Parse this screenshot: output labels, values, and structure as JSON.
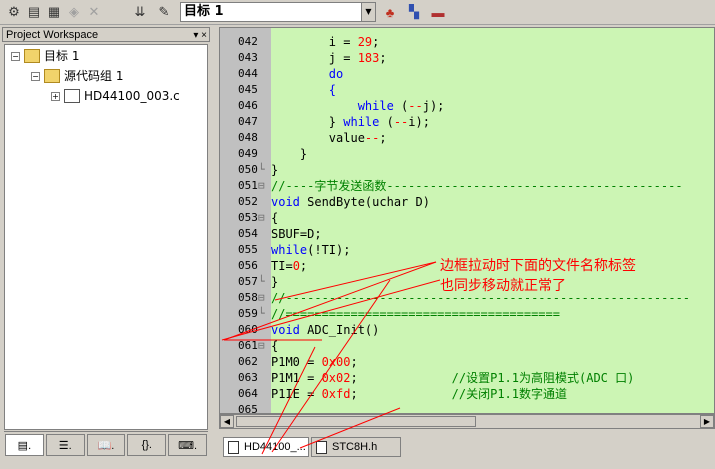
{
  "toolbar": {
    "target_value": "目标 1",
    "buttons": [
      "translate-icon",
      "build-icon",
      "rebuild-icon",
      "batch-build-icon",
      "stop-build-icon",
      "download-icon",
      "load-icon",
      "options-icon",
      "components-icon",
      "books-icon"
    ]
  },
  "workspace": {
    "title": "Project Workspace",
    "title_buttons": "▾ ×",
    "tree": {
      "root": "目标 1",
      "group": "源代码组 1",
      "file": "HD44100_003.c"
    },
    "tabs": [
      "▤.",
      "☰.",
      "📖.",
      "{}.",
      "⌨."
    ]
  },
  "editor": {
    "lines": [
      {
        "n": "042",
        "fold": "",
        "html": "        i = <span class='num'>29</span>;"
      },
      {
        "n": "043",
        "fold": "",
        "html": "        j = <span class='num'>183</span>;"
      },
      {
        "n": "044",
        "fold": "",
        "html": "        <span class='kw'>do</span>"
      },
      {
        "n": "045",
        "fold": "",
        "html": "        <span class='kw'>{</span>"
      },
      {
        "n": "046",
        "fold": "",
        "html": "            <span class='kw'>while</span> (<span class='num'>--</span>j);"
      },
      {
        "n": "047",
        "fold": "",
        "html": "        } <span class='kw'>while</span> (<span class='num'>--</span>i);"
      },
      {
        "n": "048",
        "fold": "",
        "html": "        value<span class='num'>--</span>;"
      },
      {
        "n": "049",
        "fold": "",
        "html": "    }"
      },
      {
        "n": "050",
        "fold": "└",
        "html": "}"
      },
      {
        "n": "051",
        "fold": "⊟",
        "html": "<span class='cm'>//----字节发送函数-----------------------------------------</span>"
      },
      {
        "n": "052",
        "fold": "",
        "html": "<span class='kw'>void</span> SendByte(uchar D)"
      },
      {
        "n": "053",
        "fold": "⊟",
        "html": "{"
      },
      {
        "n": "054",
        "fold": "",
        "html": "SBUF=D;"
      },
      {
        "n": "055",
        "fold": "",
        "html": "<span class='kw'>while</span>(!TI);"
      },
      {
        "n": "056",
        "fold": "",
        "html": "TI=<span class='num'>0</span>;"
      },
      {
        "n": "057",
        "fold": "└",
        "html": "}"
      },
      {
        "n": "058",
        "fold": "⊟",
        "html": "<span class='cm'>//--------------------------------------------------------</span>"
      },
      {
        "n": "059",
        "fold": "└",
        "html": "<span class='cm'>//======================================</span>"
      },
      {
        "n": "060",
        "fold": "",
        "html": "<span class='kw'>void</span> ADC_Init()"
      },
      {
        "n": "061",
        "fold": "⊟",
        "html": "{"
      },
      {
        "n": "062",
        "fold": "",
        "html": "P1M0 = <span class='num'>0x00</span>;"
      },
      {
        "n": "063",
        "fold": "",
        "html": "P1M1 = <span class='num'>0x02</span>;             <span class='cm'>//设置P1.1为高阻模式(ADC 口)</span>"
      },
      {
        "n": "064",
        "fold": "",
        "html": "P1IE = <span class='num'>0xfd</span>;             <span class='cm'>//关闭P1.1数字通道</span>"
      },
      {
        "n": "065",
        "fold": "",
        "html": ""
      }
    ]
  },
  "file_tabs": [
    "HD44100_...",
    "STC8H.h"
  ],
  "annotation": [
    "边框拉动时下面的文件名称标签",
    "也同步移动就正常了"
  ],
  "colors": {
    "editor_bg": "#ccf5b4",
    "keyword": "#0000ff",
    "number": "#ff0000",
    "comment": "#008000",
    "annotation": "#ff0000"
  }
}
